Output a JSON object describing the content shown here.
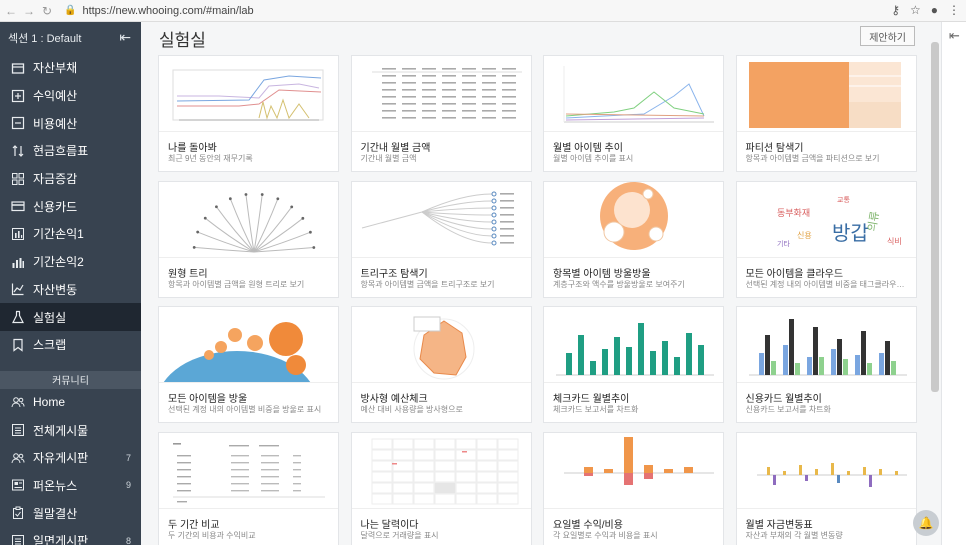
{
  "browser": {
    "url": "https://new.whooing.com/#main/lab"
  },
  "sidebar": {
    "section_label": "섹션 1 : Default",
    "items": [
      {
        "label": "자산부채",
        "icon": "wallet-icon"
      },
      {
        "label": "수익예산",
        "icon": "plus-square-icon"
      },
      {
        "label": "비용예산",
        "icon": "minus-square-icon"
      },
      {
        "label": "현금흐름표",
        "icon": "arrows-updown-icon"
      },
      {
        "label": "자금증감",
        "icon": "grid-icon"
      },
      {
        "label": "신용카드",
        "icon": "credit-card-icon"
      },
      {
        "label": "기간손익1",
        "icon": "bar-chart-icon"
      },
      {
        "label": "기간손익2",
        "icon": "bar-chart-2-icon"
      },
      {
        "label": "자산변동",
        "icon": "line-chart-icon"
      },
      {
        "label": "실험실",
        "icon": "flask-icon"
      },
      {
        "label": "스크랩",
        "icon": "bookmark-icon"
      }
    ],
    "community_label": "커뮤니티",
    "community": [
      {
        "label": "Home",
        "icon": "users-icon",
        "count": ""
      },
      {
        "label": "전체게시물",
        "icon": "list-icon",
        "count": ""
      },
      {
        "label": "자유게시판",
        "icon": "users-icon",
        "count": "7"
      },
      {
        "label": "퍼온뉴스",
        "icon": "newspaper-icon",
        "count": "9"
      },
      {
        "label": "월말결산",
        "icon": "clipboard-icon",
        "count": ""
      },
      {
        "label": "일면게시판",
        "icon": "list-icon",
        "count": "8"
      }
    ]
  },
  "main": {
    "title": "실험실",
    "suggest_label": "제안하기",
    "cards": [
      {
        "title": "나를 돌아봐",
        "desc": "최근 9년 동안의 재무기록"
      },
      {
        "title": "기간내 월별 금액",
        "desc": "기간내 월별 금액"
      },
      {
        "title": "월별 아이템 추이",
        "desc": "월별 아이템 추이를 표시"
      },
      {
        "title": "파티션 탐색기",
        "desc": "항목과 아이템별 금액을 파티션으로 보기"
      },
      {
        "title": "원형 트리",
        "desc": "항목과 아이템별 금액을 원형 트리로 보기"
      },
      {
        "title": "트리구조 탐색기",
        "desc": "항목과 아이템별 금액을 트리구조로 보기"
      },
      {
        "title": "항목별 아이템 방울방울",
        "desc": "계층구조와 액수를 방울방울로 보여주기"
      },
      {
        "title": "모든 아이템을 클라우드",
        "desc": "선택된 계정 내의 아이템별 비중을 태그클라우드로 표시"
      },
      {
        "title": "모든 아이템을 방울",
        "desc": "선택된 계정 내의 아이템별 비중을 방울로 표시"
      },
      {
        "title": "방사형 예산체크",
        "desc": "예산 대비 사용량을 방사형으로"
      },
      {
        "title": "체크카드 월별추이",
        "desc": "체크카드 보고서를 차트화"
      },
      {
        "title": "신용카드 월별추이",
        "desc": "신용카드 보고서를 차트화"
      },
      {
        "title": "두 기간 비교",
        "desc": "두 기간의 비용과 수익비교"
      },
      {
        "title": "나는 달력이다",
        "desc": "달력으로 거래량을 표시"
      },
      {
        "title": "요일별 수익/비용",
        "desc": "각 요일별로 수익과 비용을 표시"
      },
      {
        "title": "월별 자금변동표",
        "desc": "자산과 부채의 각 월별 변동량"
      }
    ]
  },
  "colors": {
    "sidebar_bg": "#384350",
    "sidebar_active": "#1f2731",
    "accent_orange": "#f0964a",
    "accent_teal": "#1f9e83"
  }
}
